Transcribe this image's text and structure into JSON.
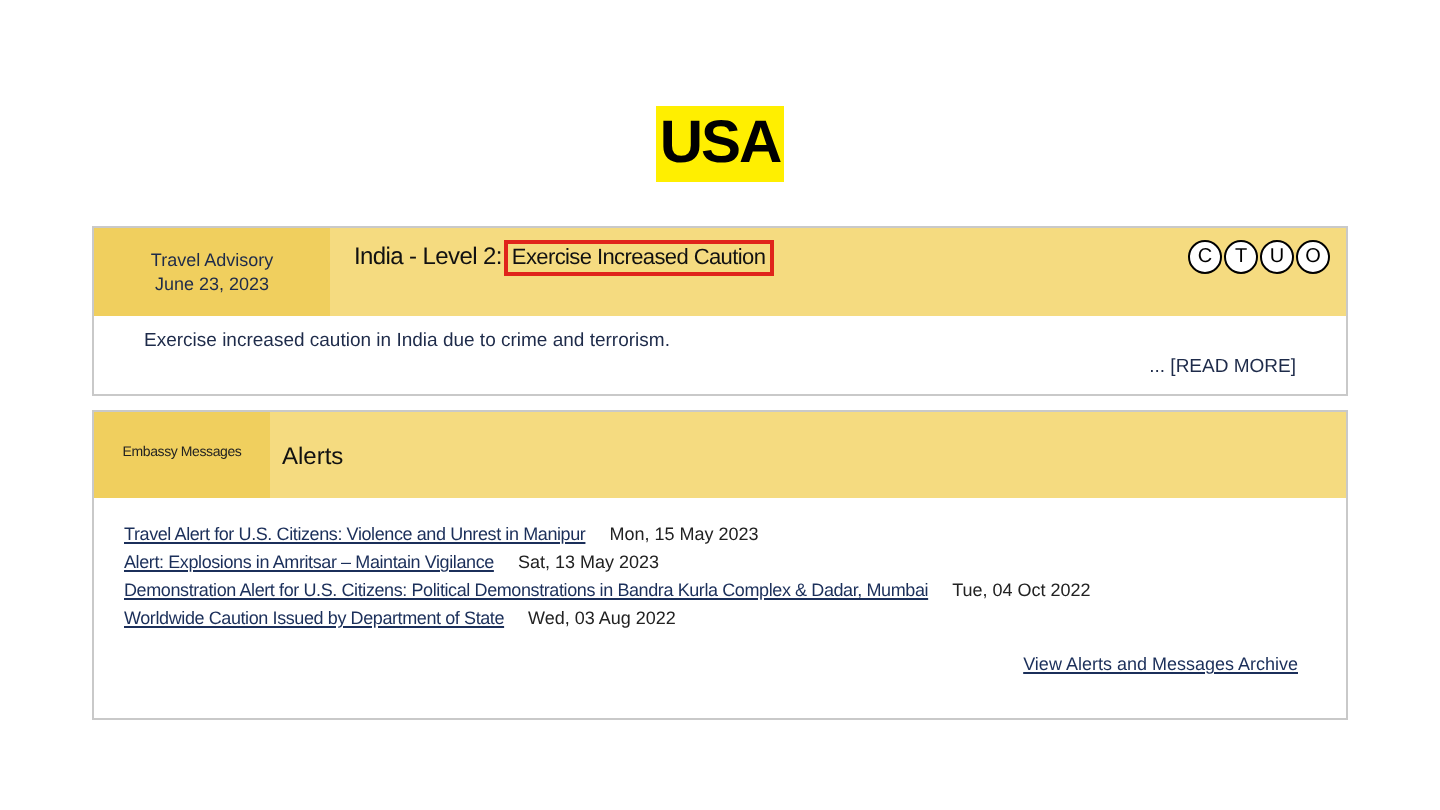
{
  "logo": "USA",
  "advisory": {
    "label": "Travel Advisory",
    "date": "June 23, 2023",
    "title": "India - Level 2:",
    "level_text": "Exercise Increased Caution",
    "highlighted": true,
    "indicators": [
      "C",
      "T",
      "U",
      "O"
    ],
    "summary": "Exercise increased caution in India due to crime and terrorism.",
    "read_more": "... [READ MORE]"
  },
  "messages": {
    "label": "Embassy Messages",
    "title": "Alerts",
    "alerts": [
      {
        "title": "Travel Alert for U.S. Citizens: Violence and Unrest in Manipur",
        "date": "Mon, 15 May 2023"
      },
      {
        "title": "Alert: Explosions in Amritsar – Maintain Vigilance",
        "date": "Sat, 13 May 2023"
      },
      {
        "title": "Demonstration Alert for U.S. Citizens:  Political Demonstrations in Bandra Kurla Complex & Dadar, Mumbai",
        "date": "Tue, 04 Oct 2022"
      },
      {
        "title": "Worldwide Caution Issued by Department of State",
        "date": "Wed, 03 Aug 2022"
      }
    ],
    "archive": "View Alerts and Messages Archive"
  }
}
